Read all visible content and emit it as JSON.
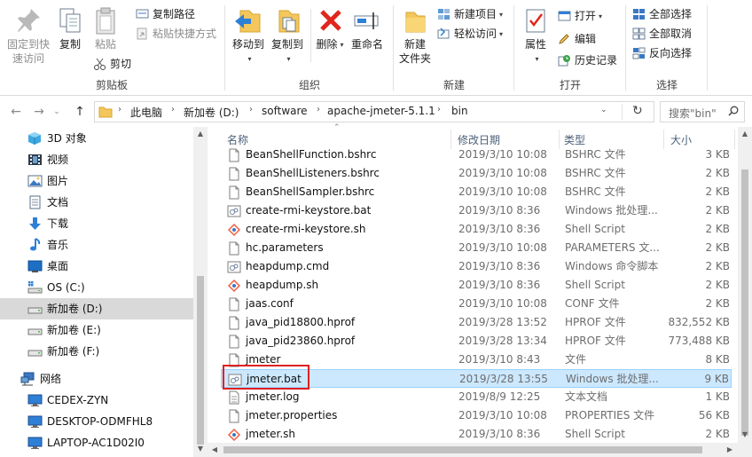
{
  "ribbon": {
    "clipboard": {
      "label": "剪贴板",
      "pin": "固定到快速访问",
      "pin_line1": "固定到快",
      "pin_line2": "速访问",
      "copy": "复制",
      "paste": "粘贴",
      "copy_path": "复制路径",
      "paste_shortcut": "粘贴快捷方式",
      "cut": "剪切"
    },
    "organize": {
      "label": "组织",
      "move_to": "移动到",
      "copy_to": "复制到",
      "delete": "删除",
      "rename": "重命名"
    },
    "new": {
      "label": "新建",
      "new_folder_line1": "新建",
      "new_folder_line2": "文件夹",
      "new_item": "新建项目",
      "easy_access": "轻松访问"
    },
    "open": {
      "label": "打开",
      "properties": "属性",
      "open": "打开",
      "edit": "编辑",
      "history": "历史记录"
    },
    "select": {
      "label": "选择",
      "select_all": "全部选择",
      "select_none": "全部取消",
      "invert": "反向选择"
    }
  },
  "address": {
    "crumbs": [
      "此电脑",
      "新加卷 (D:)",
      "software",
      "apache-jmeter-5.1.1",
      "bin"
    ],
    "search_placeholder": "搜索\"bin\""
  },
  "nav": {
    "items": [
      {
        "label": "3D 对象",
        "icon": "3d-objects-icon"
      },
      {
        "label": "视频",
        "icon": "video-icon"
      },
      {
        "label": "图片",
        "icon": "pictures-icon"
      },
      {
        "label": "文档",
        "icon": "documents-icon"
      },
      {
        "label": "下载",
        "icon": "downloads-icon"
      },
      {
        "label": "音乐",
        "icon": "music-icon"
      },
      {
        "label": "桌面",
        "icon": "desktop-icon"
      },
      {
        "label": "OS (C:)",
        "icon": "drive-os-icon"
      },
      {
        "label": "新加卷 (D:)",
        "icon": "drive-icon"
      },
      {
        "label": "新加卷 (E:)",
        "icon": "drive-icon"
      },
      {
        "label": "新加卷 (F:)",
        "icon": "drive-icon"
      },
      {
        "label": "网络",
        "icon": "network-icon"
      },
      {
        "label": "CEDEX-ZYN",
        "icon": "computer-icon"
      },
      {
        "label": "DESKTOP-ODMFHL8",
        "icon": "computer-icon"
      },
      {
        "label": "LAPTOP-AC1D02I0",
        "icon": "computer-icon"
      }
    ],
    "selected_index": 8
  },
  "columns": {
    "name": "名称",
    "date": "修改日期",
    "type": "类型",
    "size": "大小"
  },
  "files": [
    {
      "name": "BeanShellFunction.bshrc",
      "date": "2019/3/10 10:08",
      "type": "BSHRC 文件",
      "size": "3 KB",
      "icon": "file-icon"
    },
    {
      "name": "BeanShellListeners.bshrc",
      "date": "2019/3/10 10:08",
      "type": "BSHRC 文件",
      "size": "2 KB",
      "icon": "file-icon"
    },
    {
      "name": "BeanShellSampler.bshrc",
      "date": "2019/3/10 10:08",
      "type": "BSHRC 文件",
      "size": "2 KB",
      "icon": "file-icon"
    },
    {
      "name": "create-rmi-keystore.bat",
      "date": "2019/3/10 8:36",
      "type": "Windows 批处理...",
      "size": "2 KB",
      "icon": "batch-file-icon"
    },
    {
      "name": "create-rmi-keystore.sh",
      "date": "2019/3/10 8:36",
      "type": "Shell Script",
      "size": "2 KB",
      "icon": "shell-script-icon"
    },
    {
      "name": "hc.parameters",
      "date": "2019/3/10 10:08",
      "type": "PARAMETERS 文...",
      "size": "2 KB",
      "icon": "file-icon"
    },
    {
      "name": "heapdump.cmd",
      "date": "2019/3/10 8:36",
      "type": "Windows 命令脚本",
      "size": "2 KB",
      "icon": "batch-file-icon"
    },
    {
      "name": "heapdump.sh",
      "date": "2019/3/10 8:36",
      "type": "Shell Script",
      "size": "2 KB",
      "icon": "shell-script-icon"
    },
    {
      "name": "jaas.conf",
      "date": "2019/3/10 10:08",
      "type": "CONF 文件",
      "size": "2 KB",
      "icon": "file-icon"
    },
    {
      "name": "java_pid18800.hprof",
      "date": "2019/3/28 13:52",
      "type": "HPROF 文件",
      "size": "832,552 KB",
      "icon": "file-icon"
    },
    {
      "name": "java_pid23860.hprof",
      "date": "2019/3/28 13:34",
      "type": "HPROF 文件",
      "size": "773,488 KB",
      "icon": "file-icon"
    },
    {
      "name": "jmeter",
      "date": "2019/3/10 8:43",
      "type": "文件",
      "size": "8 KB",
      "icon": "file-icon"
    },
    {
      "name": "jmeter.bat",
      "date": "2019/3/28 13:55",
      "type": "Windows 批处理...",
      "size": "9 KB",
      "icon": "batch-file-icon"
    },
    {
      "name": "jmeter.log",
      "date": "2019/8/9 12:25",
      "type": "文本文档",
      "size": "1 KB",
      "icon": "text-file-icon"
    },
    {
      "name": "jmeter.properties",
      "date": "2019/3/10 10:08",
      "type": "PROPERTIES 文件",
      "size": "56 KB",
      "icon": "file-icon"
    },
    {
      "name": "jmeter.sh",
      "date": "2019/3/10 8:36",
      "type": "Shell Script",
      "size": "2 KB",
      "icon": "shell-script-icon"
    }
  ],
  "selected_file_index": 12,
  "colors": {
    "selection_bg": "#cce8ff",
    "selection_border": "#99d1ff",
    "highlight_box": "#e02020",
    "header_text": "#4c607a"
  }
}
